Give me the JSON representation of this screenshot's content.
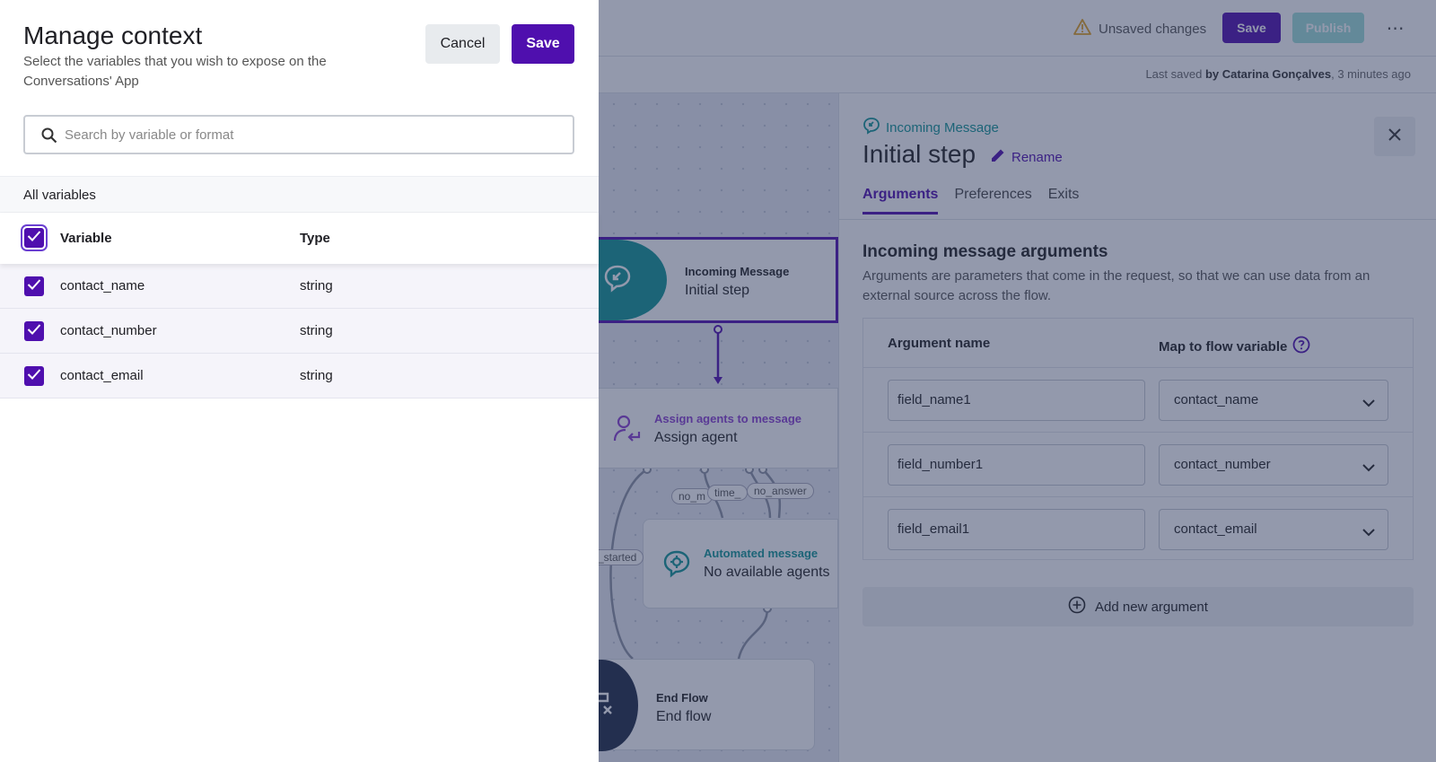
{
  "header": {
    "unsaved_label": "Unsaved changes",
    "save_label": "Save",
    "publish_label": "Publish",
    "more_label": "⋯",
    "last_saved_prefix": "Last saved ",
    "last_saved_by_label": "by Catarina Gonçalves",
    "last_saved_suffix": ", 3 minutes ago"
  },
  "canvas": {
    "nodes": {
      "incoming": {
        "label": "Incoming Message",
        "title": "Initial step"
      },
      "assign": {
        "label": "Assign agents to message",
        "title": "Assign agent"
      },
      "automated": {
        "label": "Automated message",
        "title": "No available agents"
      },
      "end": {
        "label": "End Flow",
        "title": "End flow"
      }
    },
    "chips": {
      "no_m": "no_m",
      "time": "time_",
      "no_answer": "no_answer",
      "started": "_started"
    }
  },
  "panel": {
    "sublabel": "Incoming Message",
    "title": "Initial step",
    "rename_label": "Rename",
    "tabs": [
      "Arguments",
      "Preferences",
      "Exits"
    ],
    "heading": "Incoming message arguments",
    "description": "Arguments are parameters that come in the request, so that we can use data from an external source across the flow.",
    "table_headers": {
      "name": "Argument name",
      "map": "Map to flow variable"
    },
    "arguments": [
      {
        "name": "field_name1",
        "variable": "contact_name"
      },
      {
        "name": "field_number1",
        "variable": "contact_number"
      },
      {
        "name": "field_email1",
        "variable": "contact_email"
      }
    ],
    "add_label": "Add new argument"
  },
  "drawer": {
    "title": "Manage context",
    "subtitle": "Select the variables that you wish to expose on the Conversations' App",
    "cancel_label": "Cancel",
    "save_label": "Save",
    "search_placeholder": "Search by variable or format",
    "section_label": "All variables",
    "headers": {
      "variable": "Variable",
      "type": "Type"
    },
    "rows": [
      {
        "variable": "contact_name",
        "type": "string",
        "checked": true
      },
      {
        "variable": "contact_number",
        "type": "string",
        "checked": true
      },
      {
        "variable": "contact_email",
        "type": "string",
        "checked": true
      }
    ]
  },
  "colors": {
    "brand": "#4f0fae",
    "teal": "#119595",
    "publish_disabled": "#9edfd8",
    "warning": "#e0a020",
    "node_dark": "#1f2a44"
  },
  "icons": [
    "warning-icon",
    "close-icon",
    "pencil-icon",
    "help-icon",
    "plus-circle-icon",
    "search-icon",
    "check-icon",
    "chevron-down-icon",
    "incoming-message-icon",
    "assign-agent-icon",
    "automated-message-icon",
    "end-flow-icon"
  ]
}
